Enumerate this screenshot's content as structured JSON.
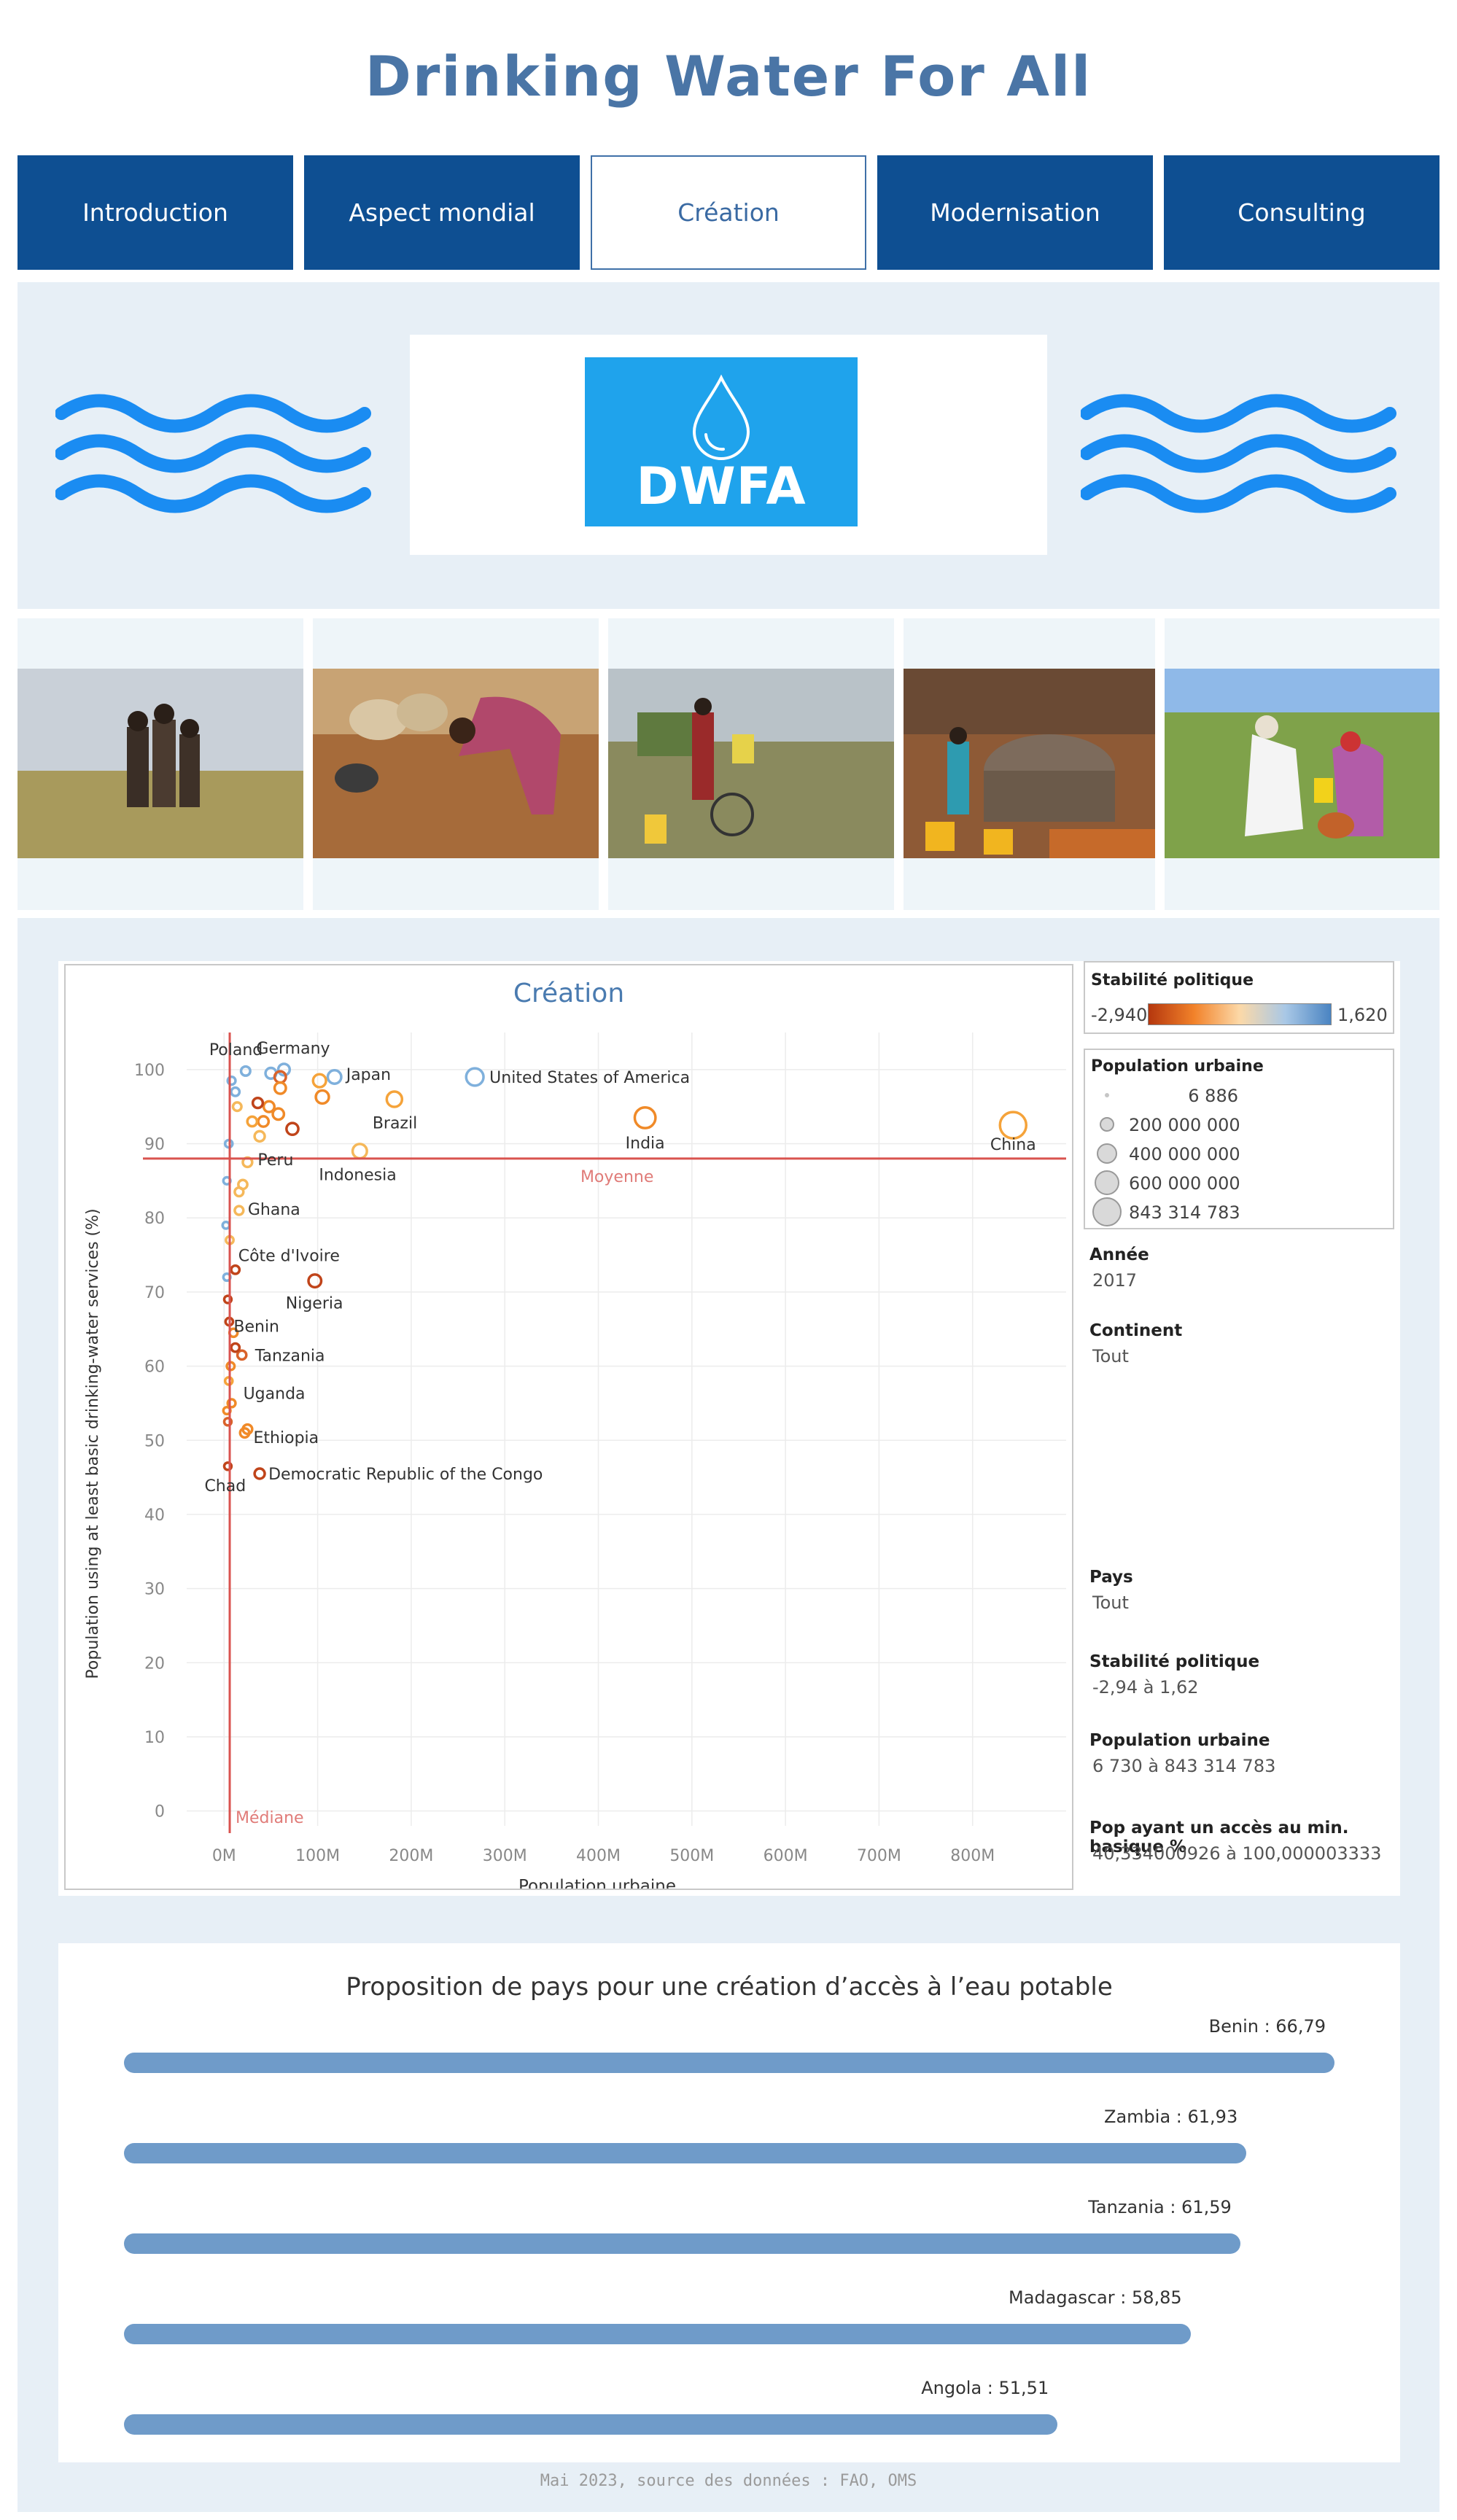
{
  "page": {
    "title": "Drinking Water For All"
  },
  "nav": {
    "tabs": [
      {
        "label": "Introduction",
        "active": false
      },
      {
        "label": "Aspect mondial",
        "active": false
      },
      {
        "label": "Création",
        "active": true
      },
      {
        "label": "Modernisation",
        "active": false
      },
      {
        "label": "Consulting",
        "active": false
      }
    ]
  },
  "hero": {
    "logo_text": "DWFA",
    "logo_color": "#1fa3ec",
    "wave_color": "#1a8cf2"
  },
  "photos": [
    {
      "subject": "children-standing-in-grass"
    },
    {
      "subject": "woman-digging-sand"
    },
    {
      "subject": "person-with-bicycle-and-jerrycans"
    },
    {
      "subject": "people-at-village-well"
    },
    {
      "subject": "man-pouring-water-for-woman"
    }
  ],
  "chart_data": {
    "type": "scatter",
    "title": "Création",
    "xlabel": "Population urbaine",
    "ylabel": "Population using at least basic drinking-water services (%)",
    "xlim": [
      -40000000,
      900000000
    ],
    "ylim": [
      -2,
      105
    ],
    "x_ticks": [
      {
        "v": 0,
        "label": "0M"
      },
      {
        "v": 100000000,
        "label": "100M"
      },
      {
        "v": 200000000,
        "label": "200M"
      },
      {
        "v": 300000000,
        "label": "300M"
      },
      {
        "v": 400000000,
        "label": "400M"
      },
      {
        "v": 500000000,
        "label": "500M"
      },
      {
        "v": 600000000,
        "label": "600M"
      },
      {
        "v": 700000000,
        "label": "700M"
      },
      {
        "v": 800000000,
        "label": "800M"
      }
    ],
    "y_ticks": [
      0,
      10,
      20,
      30,
      40,
      50,
      60,
      70,
      80,
      90,
      100
    ],
    "reference_lines": [
      {
        "axis": "y",
        "value": 88,
        "label": "Moyenne",
        "color": "#d9534f"
      },
      {
        "axis": "x",
        "value": 6000000,
        "label": "Médiane",
        "color": "#d9534f"
      }
    ],
    "points": [
      {
        "label": "China",
        "x": 843314783,
        "y": 92.5,
        "color": "#f5a33a"
      },
      {
        "label": "India",
        "x": 450000000,
        "y": 93.5,
        "color": "#f08a28"
      },
      {
        "label": "United States of America",
        "x": 268000000,
        "y": 99,
        "color": "#7fb0dc"
      },
      {
        "label": "Brazil",
        "x": 182000000,
        "y": 96,
        "color": "#f5a33a"
      },
      {
        "label": "Japan",
        "x": 118000000,
        "y": 99,
        "color": "#7fb0dc"
      },
      {
        "label": "Germany",
        "x": 64000000,
        "y": 100,
        "color": "#7fb0dc"
      },
      {
        "label": "Indonesia",
        "x": 145000000,
        "y": 89,
        "color": "#f5b85a"
      },
      {
        "label": "Nigeria",
        "x": 97000000,
        "y": 71.5,
        "color": "#c0441a"
      },
      {
        "label": "Poland",
        "x": 23000000,
        "y": 99.8,
        "color": "#7fb0dc"
      },
      {
        "label": "Peru",
        "x": 25000000,
        "y": 87.5,
        "color": "#f5b85a"
      },
      {
        "label": "Ghana",
        "x": 16000000,
        "y": 81,
        "color": "#f5b85a"
      },
      {
        "label": "Côte d'Ivoire",
        "x": 12000000,
        "y": 73,
        "color": "#c0441a"
      },
      {
        "label": "Benin",
        "x": 5500000,
        "y": 66,
        "color": "#c0441a"
      },
      {
        "label": "Tanzania",
        "x": 19000000,
        "y": 61.5,
        "color": "#d9622a"
      },
      {
        "label": "Uganda",
        "x": 8000000,
        "y": 55,
        "color": "#f08a28"
      },
      {
        "label": "Ethiopia",
        "x": 22000000,
        "y": 51,
        "color": "#f08a28"
      },
      {
        "label": "Democratic Republic of the Congo",
        "x": 38000000,
        "y": 45.5,
        "color": "#c0441a"
      },
      {
        "label": "Chad",
        "x": 4000000,
        "y": 46.5,
        "color": "#c0441a"
      },
      {
        "label": "",
        "x": 50000000,
        "y": 99.5,
        "color": "#7fb0dc"
      },
      {
        "label": "",
        "x": 60000000,
        "y": 99,
        "color": "#d9622a"
      },
      {
        "label": "",
        "x": 60000000,
        "y": 97.5,
        "color": "#f08a28"
      },
      {
        "label": "",
        "x": 105000000,
        "y": 96.3,
        "color": "#f08a28"
      },
      {
        "label": "",
        "x": 102000000,
        "y": 98.5,
        "color": "#f5a33a"
      },
      {
        "label": "",
        "x": 48000000,
        "y": 95,
        "color": "#f08a28"
      },
      {
        "label": "",
        "x": 58000000,
        "y": 94,
        "color": "#f08a28"
      },
      {
        "label": "",
        "x": 73000000,
        "y": 92,
        "color": "#c0441a"
      },
      {
        "label": "",
        "x": 36000000,
        "y": 95.5,
        "color": "#c0441a"
      },
      {
        "label": "",
        "x": 42000000,
        "y": 93,
        "color": "#f08a28"
      },
      {
        "label": "",
        "x": 30000000,
        "y": 93,
        "color": "#f5a33a"
      },
      {
        "label": "",
        "x": 38000000,
        "y": 91,
        "color": "#f5b85a"
      },
      {
        "label": "",
        "x": 20000000,
        "y": 84.5,
        "color": "#f5b85a"
      },
      {
        "label": "",
        "x": 16000000,
        "y": 83.5,
        "color": "#f5b85a"
      },
      {
        "label": "",
        "x": 12000000,
        "y": 97,
        "color": "#7fb0dc"
      },
      {
        "label": "",
        "x": 8000000,
        "y": 98.5,
        "color": "#7fb0dc"
      },
      {
        "label": "",
        "x": 14000000,
        "y": 95,
        "color": "#f5b85a"
      },
      {
        "label": "",
        "x": 5000000,
        "y": 90,
        "color": "#7fb0dc"
      },
      {
        "label": "",
        "x": 3000000,
        "y": 85,
        "color": "#7fb0dc"
      },
      {
        "label": "",
        "x": 2000000,
        "y": 79,
        "color": "#7fb0dc"
      },
      {
        "label": "",
        "x": 6000000,
        "y": 77,
        "color": "#f5b85a"
      },
      {
        "label": "",
        "x": 3000000,
        "y": 72,
        "color": "#7fb0dc"
      },
      {
        "label": "",
        "x": 4000000,
        "y": 69,
        "color": "#c0441a"
      },
      {
        "label": "",
        "x": 10000000,
        "y": 64.5,
        "color": "#f08a28"
      },
      {
        "label": "",
        "x": 7000000,
        "y": 60,
        "color": "#f08a28"
      },
      {
        "label": "",
        "x": 5000000,
        "y": 58,
        "color": "#f5a33a"
      },
      {
        "label": "",
        "x": 12000000,
        "y": 62.5,
        "color": "#c0441a"
      },
      {
        "label": "",
        "x": 3000000,
        "y": 54,
        "color": "#f08a28"
      },
      {
        "label": "",
        "x": 25000000,
        "y": 51.5,
        "color": "#f08a28"
      },
      {
        "label": "",
        "x": 4000000,
        "y": 52.5,
        "color": "#d9622a"
      }
    ]
  },
  "legends": {
    "stability": {
      "title": "Stabilité politique",
      "min_label": "-2,940",
      "max_label": "1,620",
      "colors": [
        "#b5370e",
        "#f2822a",
        "#fcd9a8",
        "#a9c8e6",
        "#4a84c2"
      ]
    },
    "population": {
      "title": "Population urbaine",
      "items": [
        "6 886",
        "200 000 000",
        "400 000 000",
        "600 000 000",
        "843 314 783"
      ]
    }
  },
  "filters": [
    {
      "label": "Année",
      "value": "2017"
    },
    {
      "label": "Continent",
      "value": "Tout"
    },
    {
      "label": "Pays",
      "value": "Tout"
    },
    {
      "label": "Stabilité politique",
      "value": "-2,94 à 1,62"
    },
    {
      "label": "Population urbaine",
      "value": "6 730 à 843 314 783"
    },
    {
      "label": "Pop ayant un accès au min. basique %",
      "value": "40,334000926 à 100,000003333"
    }
  ],
  "proposals": {
    "title": "Proposition de pays pour une création d’accès à l’eau potable",
    "bar_color": "#6f9bc9",
    "items": [
      {
        "label": "Benin : 66,79",
        "value": 66.79
      },
      {
        "label": "Zambia : 61,93",
        "value": 61.93
      },
      {
        "label": "Tanzania : 61,59",
        "value": 61.59
      },
      {
        "label": "Madagascar : 58,85",
        "value": 58.85
      },
      {
        "label": "Angola : 51,51",
        "value": 51.51
      }
    ]
  },
  "footer": {
    "text": "Mai 2023, source des données : FAO, OMS"
  }
}
